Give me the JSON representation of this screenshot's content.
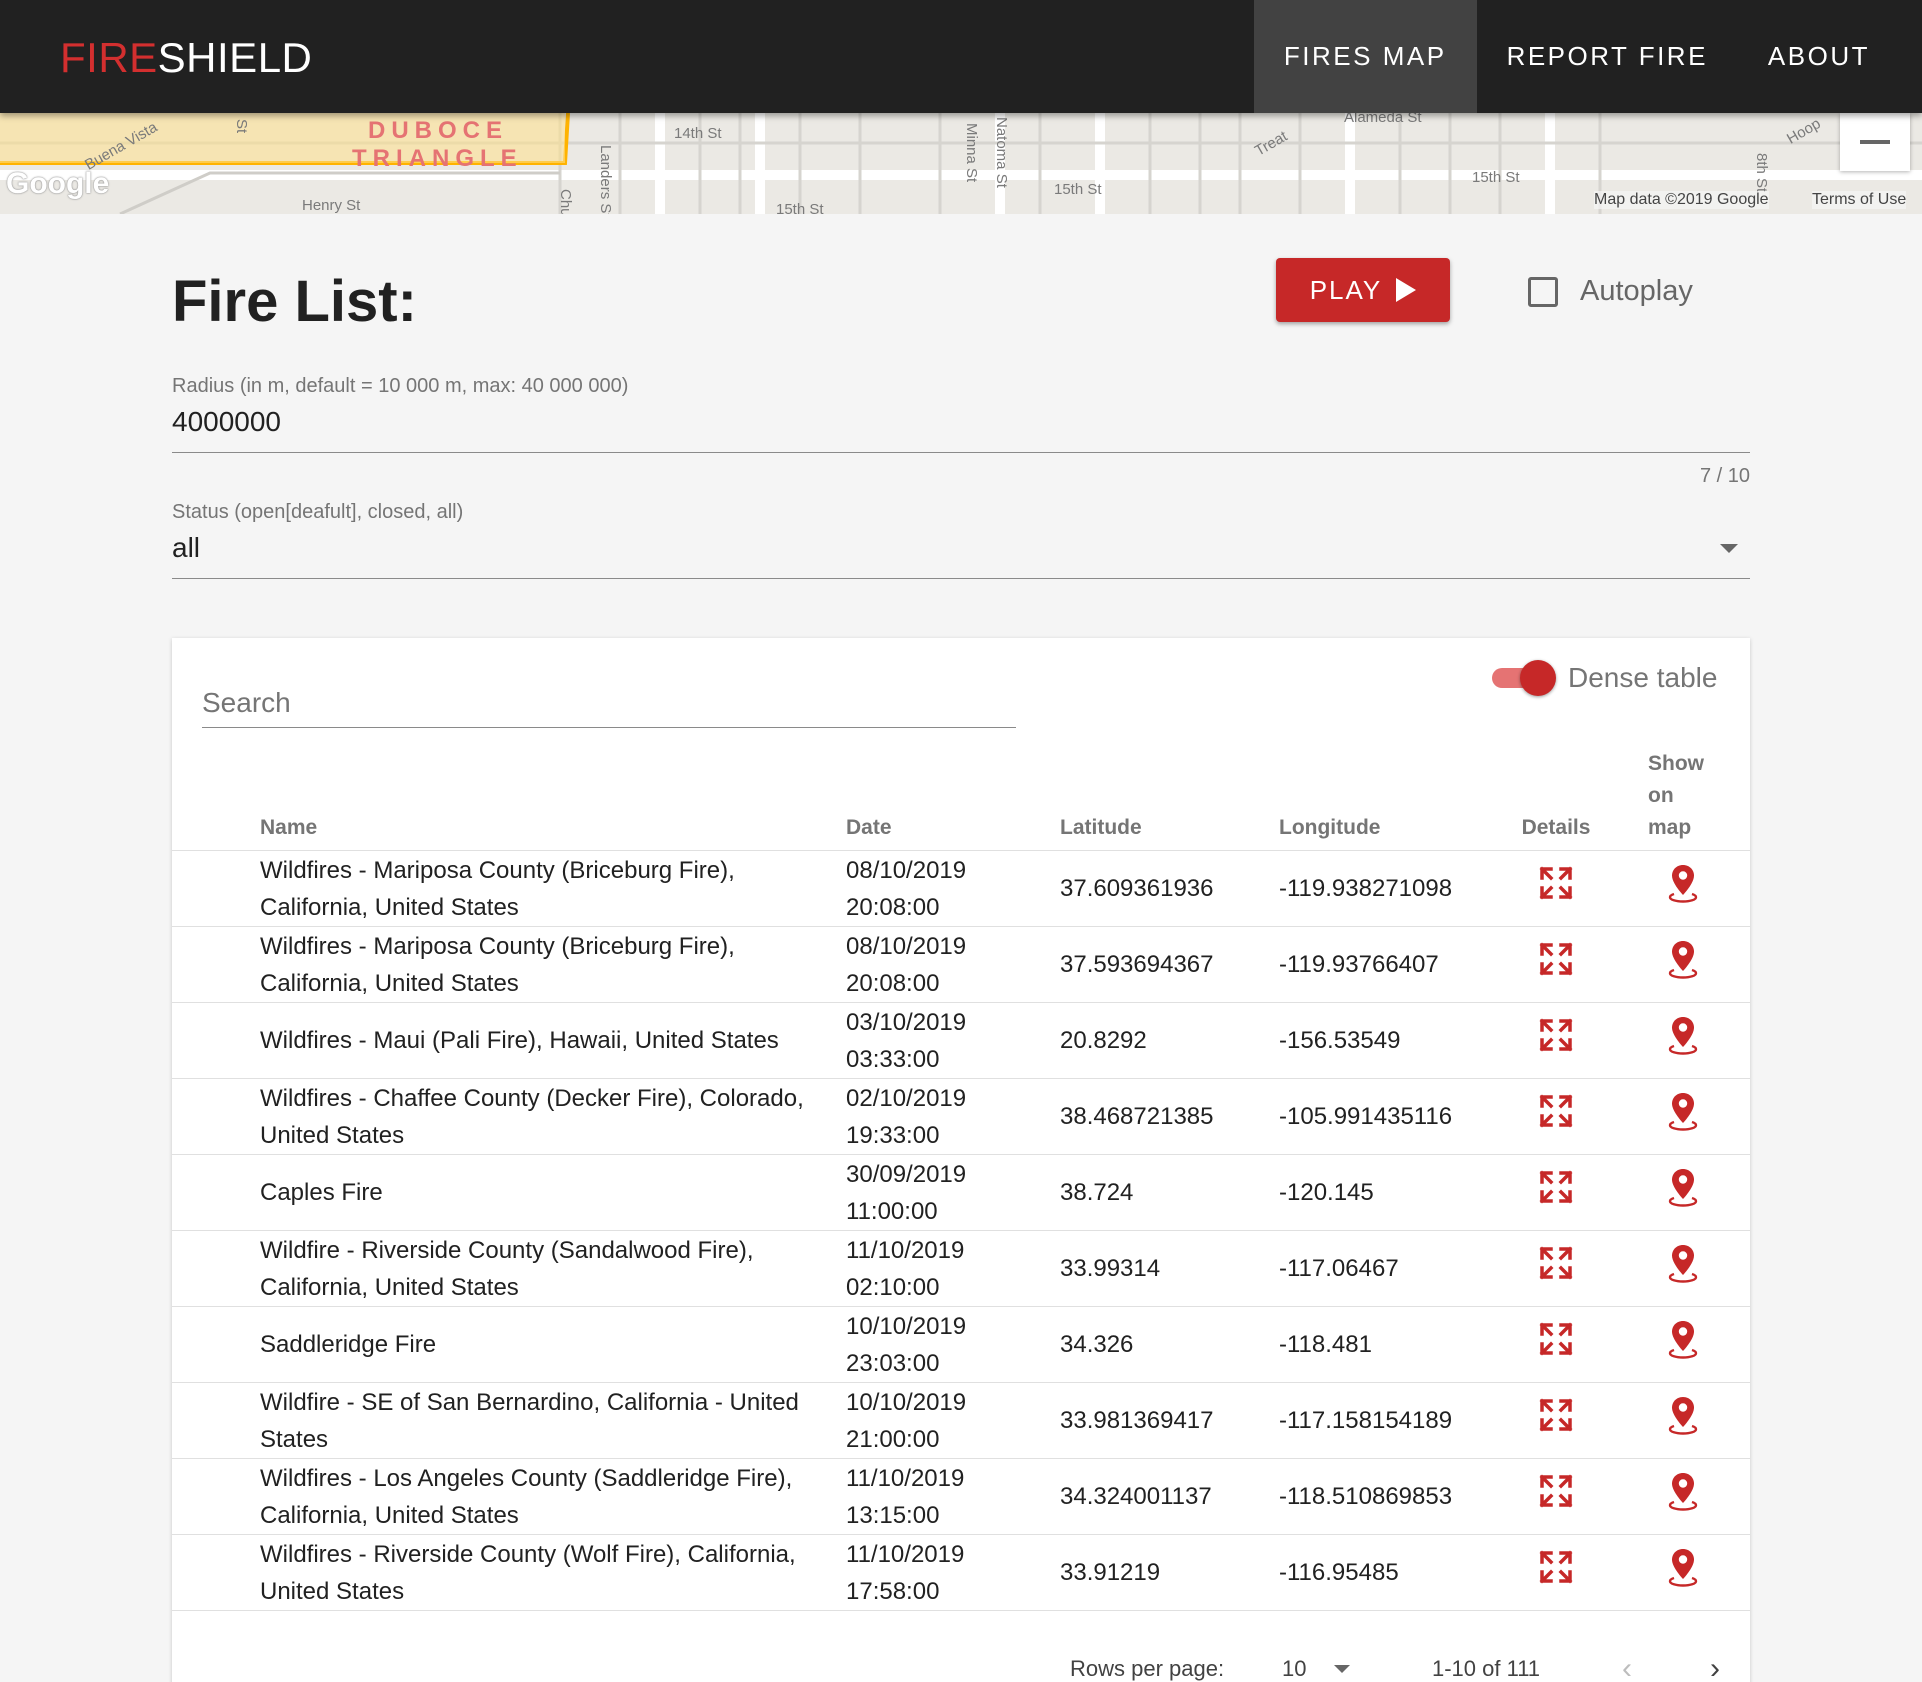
{
  "brand": {
    "fire": "FIRE",
    "shield": "SHIELD"
  },
  "nav": {
    "items": [
      "FIRES MAP",
      "REPORT FIRE",
      "ABOUT"
    ],
    "active": "FIRES MAP"
  },
  "map": {
    "streets": [
      "14th St",
      "Henry St",
      "Landers St",
      "Minna St",
      "Natoma St",
      "15th St",
      "15th St",
      "15th St",
      "Alameda St",
      "Treat",
      "Buena Vista",
      "8th St",
      "Hoop",
      "St",
      "Chu"
    ],
    "neighborhood": [
      "DUBOCE",
      "TRIANGLE"
    ],
    "logo": "Google",
    "attribution": "Map data ©2019 Google",
    "terms": "Terms of Use"
  },
  "page_title": "Fire List:",
  "play": {
    "label": "PLAY"
  },
  "autoplay": {
    "label": "Autoplay",
    "checked": false
  },
  "radius": {
    "label": "Radius (in m, default = 10 000 m, max: 40 000 000)",
    "value": "4000000",
    "counter": "7 / 10"
  },
  "status": {
    "label": "Status (open[deafult], closed, all)",
    "value": "all"
  },
  "table": {
    "search_placeholder": "Search",
    "dense_label": "Dense table",
    "dense_on": true,
    "headers": {
      "name": "Name",
      "date": "Date",
      "latitude": "Latitude",
      "longitude": "Longitude",
      "details": "Details",
      "show_on_map": "Show on map"
    },
    "rows": [
      {
        "name": "Wildfires - Mariposa County (Briceburg Fire), California, United States",
        "date": "08/10/2019 20:08:00",
        "lat": "37.609361936",
        "lon": "-119.938271098"
      },
      {
        "name": "Wildfires - Mariposa County (Briceburg Fire), California, United States",
        "date": "08/10/2019 20:08:00",
        "lat": "37.593694367",
        "lon": "-119.93766407"
      },
      {
        "name": "Wildfires - Maui (Pali Fire), Hawaii, United States",
        "date": "03/10/2019 03:33:00",
        "lat": "20.8292",
        "lon": "-156.53549"
      },
      {
        "name": "Wildfires - Chaffee County (Decker Fire), Colorado, United States",
        "date": "02/10/2019 19:33:00",
        "lat": "38.468721385",
        "lon": "-105.991435116"
      },
      {
        "name": "Caples Fire",
        "date": "30/09/2019 11:00:00",
        "lat": "38.724",
        "lon": "-120.145"
      },
      {
        "name": "Wildfire - Riverside County (Sandalwood Fire), California, United States",
        "date": "11/10/2019 02:10:00",
        "lat": "33.99314",
        "lon": "-117.06467"
      },
      {
        "name": "Saddleridge Fire",
        "date": "10/10/2019 23:03:00",
        "lat": "34.326",
        "lon": "-118.481"
      },
      {
        "name": "Wildfire - SE of San Bernardino, California - United States",
        "date": "10/10/2019 21:00:00",
        "lat": "33.981369417",
        "lon": "-117.158154189"
      },
      {
        "name": "Wildfires - Los Angeles County (Saddleridge Fire), California, United States",
        "date": "11/10/2019 13:15:00",
        "lat": "34.324001137",
        "lon": "-118.510869853"
      },
      {
        "name": "Wildfires - Riverside County (Wolf Fire), California, United States",
        "date": "11/10/2019 17:58:00",
        "lat": "33.91219",
        "lon": "-116.95485"
      }
    ],
    "icons": {
      "details": "expand-arrows-icon",
      "show_on_map": "map-pin-icon"
    },
    "accent_color": "#c62828"
  },
  "pagination": {
    "rows_per_page_label": "Rows per page:",
    "rows_per_page": "10",
    "range": "1-10 of 111"
  }
}
